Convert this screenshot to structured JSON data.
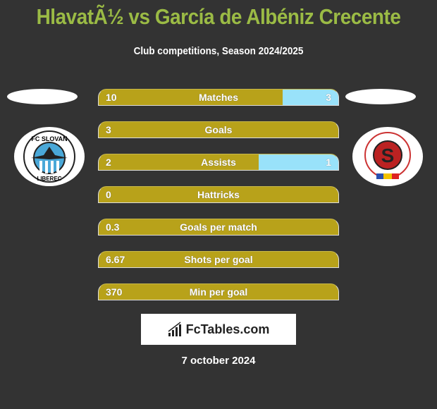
{
  "title": "HlavatÃ½ vs García de Albéniz Crecente",
  "subtitle": "Club competitions, Season 2024/2025",
  "left_team": {
    "logo_text": "FC SLOVAN LIBEREC"
  },
  "right_team": {
    "logo_text": "AC SPARTA PRAHA FOTBAL"
  },
  "colors": {
    "left": "#b8a21a",
    "right": "#99e2fa",
    "title": "#9bbb45"
  },
  "stats": [
    {
      "label": "Matches",
      "left": "10",
      "right": "3",
      "left_share": 0.769
    },
    {
      "label": "Goals",
      "left": "3",
      "right": "",
      "left_share": 1
    },
    {
      "label": "Assists",
      "left": "2",
      "right": "1",
      "left_share": 0.667
    },
    {
      "label": "Hattricks",
      "left": "0",
      "right": "",
      "left_share": 1
    },
    {
      "label": "Goals per match",
      "left": "0.3",
      "right": "",
      "left_share": 1
    },
    {
      "label": "Shots per goal",
      "left": "6.67",
      "right": "",
      "left_share": 1
    },
    {
      "label": "Min per goal",
      "left": "370",
      "right": "",
      "left_share": 1
    }
  ],
  "brand": "FcTables.com",
  "date": "7 october 2024"
}
